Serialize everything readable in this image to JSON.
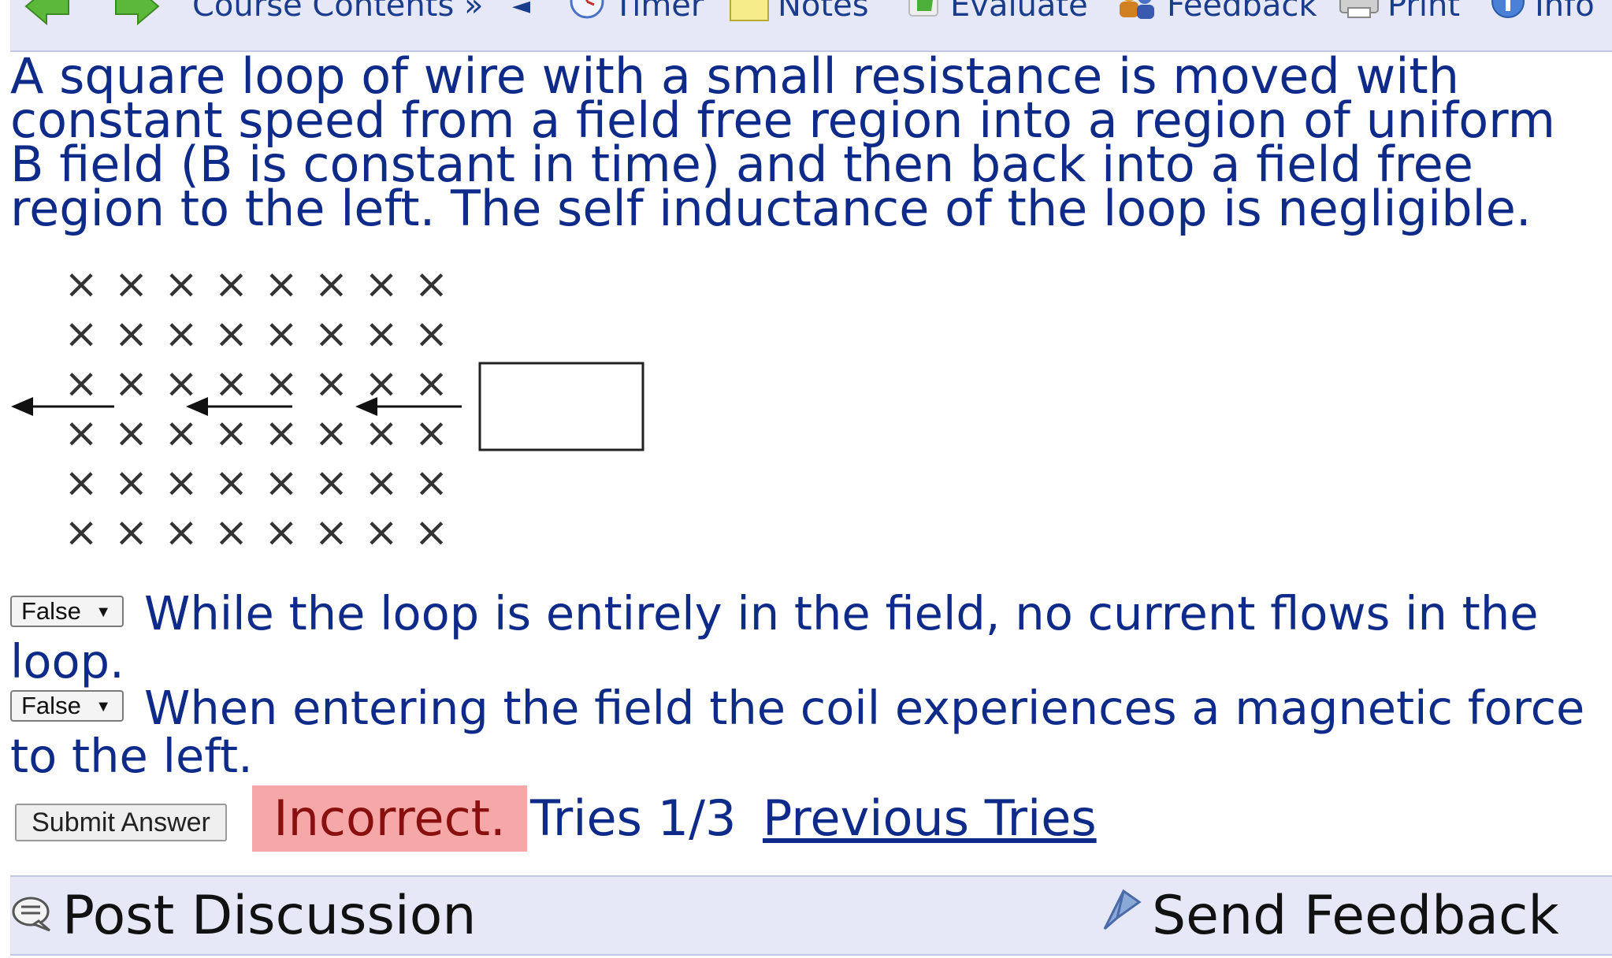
{
  "toolbar": {
    "back_label": "",
    "forward_label": "",
    "course_contents": "Course Contents »",
    "collapse_glyph": "◄",
    "timer": "Timer",
    "notes": "Notes",
    "evaluate": "Evaluate",
    "feedback": "Feedback",
    "print": "Print",
    "info": "Info"
  },
  "question": {
    "text": "A square loop of wire with a small resistance is moved with constant speed from a field free region into a region of uniform B field (B is constant in time) and then back into a field free region to the left. The self inductance of the loop is negligible."
  },
  "diagram": {
    "field_symbol": "×",
    "field_rows": 6,
    "field_cols": 8,
    "arrow_count": 3,
    "motion_direction": "left"
  },
  "statements": [
    {
      "selected": "False",
      "text": "While the loop is entirely in the field, no current flows in the loop."
    },
    {
      "selected": "False",
      "text": "When entering the field the coil experiences a magnetic force to the left."
    }
  ],
  "submit": {
    "button_label": "Submit Answer",
    "result": "Incorrect.",
    "tries": "Tries 1/3",
    "previous_tries": "Previous Tries"
  },
  "footer": {
    "post_discussion": "Post Discussion",
    "send_feedback": "Send Feedback"
  },
  "colors": {
    "text_blue": "#0f2b8a",
    "toolbar_bg": "#e6e8f7",
    "incorrect_bg": "#f6a8a8",
    "incorrect_text": "#8a0f0f"
  }
}
